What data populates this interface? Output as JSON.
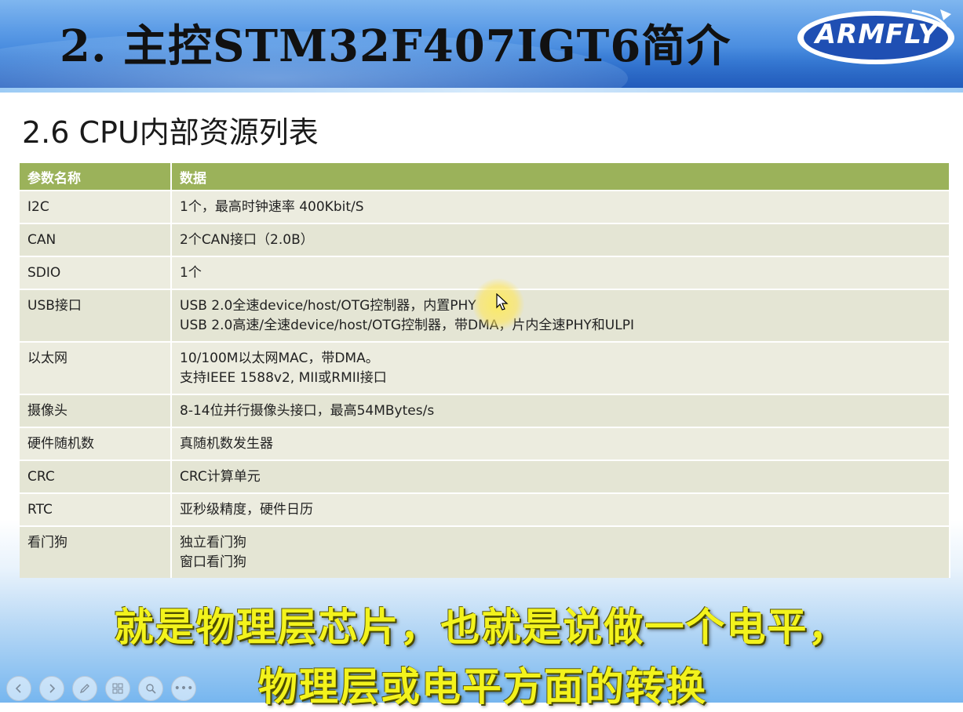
{
  "header": {
    "title": "2. 主控STM32F407IGT6简介",
    "logo_text": "ARMFLY"
  },
  "subtitle": "2.6 CPU内部资源列表",
  "table": {
    "headers": [
      "参数名称",
      "数据"
    ],
    "rows": [
      {
        "name": "I2C",
        "lines": [
          "1个，最高时钟速率 400Kbit/S"
        ]
      },
      {
        "name": "CAN",
        "lines": [
          "2个CAN接口（2.0B）"
        ]
      },
      {
        "name": "SDIO",
        "lines": [
          "1个"
        ]
      },
      {
        "name": "USB接口",
        "lines": [
          "USB 2.0全速device/host/OTG控制器，内置PHY",
          "USB 2.0高速/全速device/host/OTG控制器，带DMA，片内全速PHY和ULPI"
        ]
      },
      {
        "name": "以太网",
        "lines": [
          "10/100M以太网MAC，带DMA。",
          "支持IEEE 1588v2, MII或RMII接口"
        ]
      },
      {
        "name": "摄像头",
        "lines": [
          "8-14位并行摄像头接口，最高54MBytes/s"
        ]
      },
      {
        "name": "硬件随机数",
        "lines": [
          "真随机数发生器"
        ]
      },
      {
        "name": "CRC",
        "lines": [
          "CRC计算单元"
        ]
      },
      {
        "name": "RTC",
        "lines": [
          "亚秒级精度，硬件日历"
        ]
      },
      {
        "name": "看门狗",
        "lines": [
          "独立看门狗",
          "窗口看门狗"
        ]
      }
    ]
  },
  "captions": {
    "line1": "就是物理层芯片，也就是说做一个电平，",
    "line2": "物理层或电平方面的转换"
  },
  "nav": {
    "buttons": [
      "prev-icon",
      "next-icon",
      "pen-icon",
      "slides-icon",
      "zoom-icon",
      "more-icon"
    ],
    "more_label": "•••"
  },
  "colors": {
    "table_header": "#9bb25a",
    "row_bg": "#ececdf",
    "caption": "#f3f31c"
  }
}
